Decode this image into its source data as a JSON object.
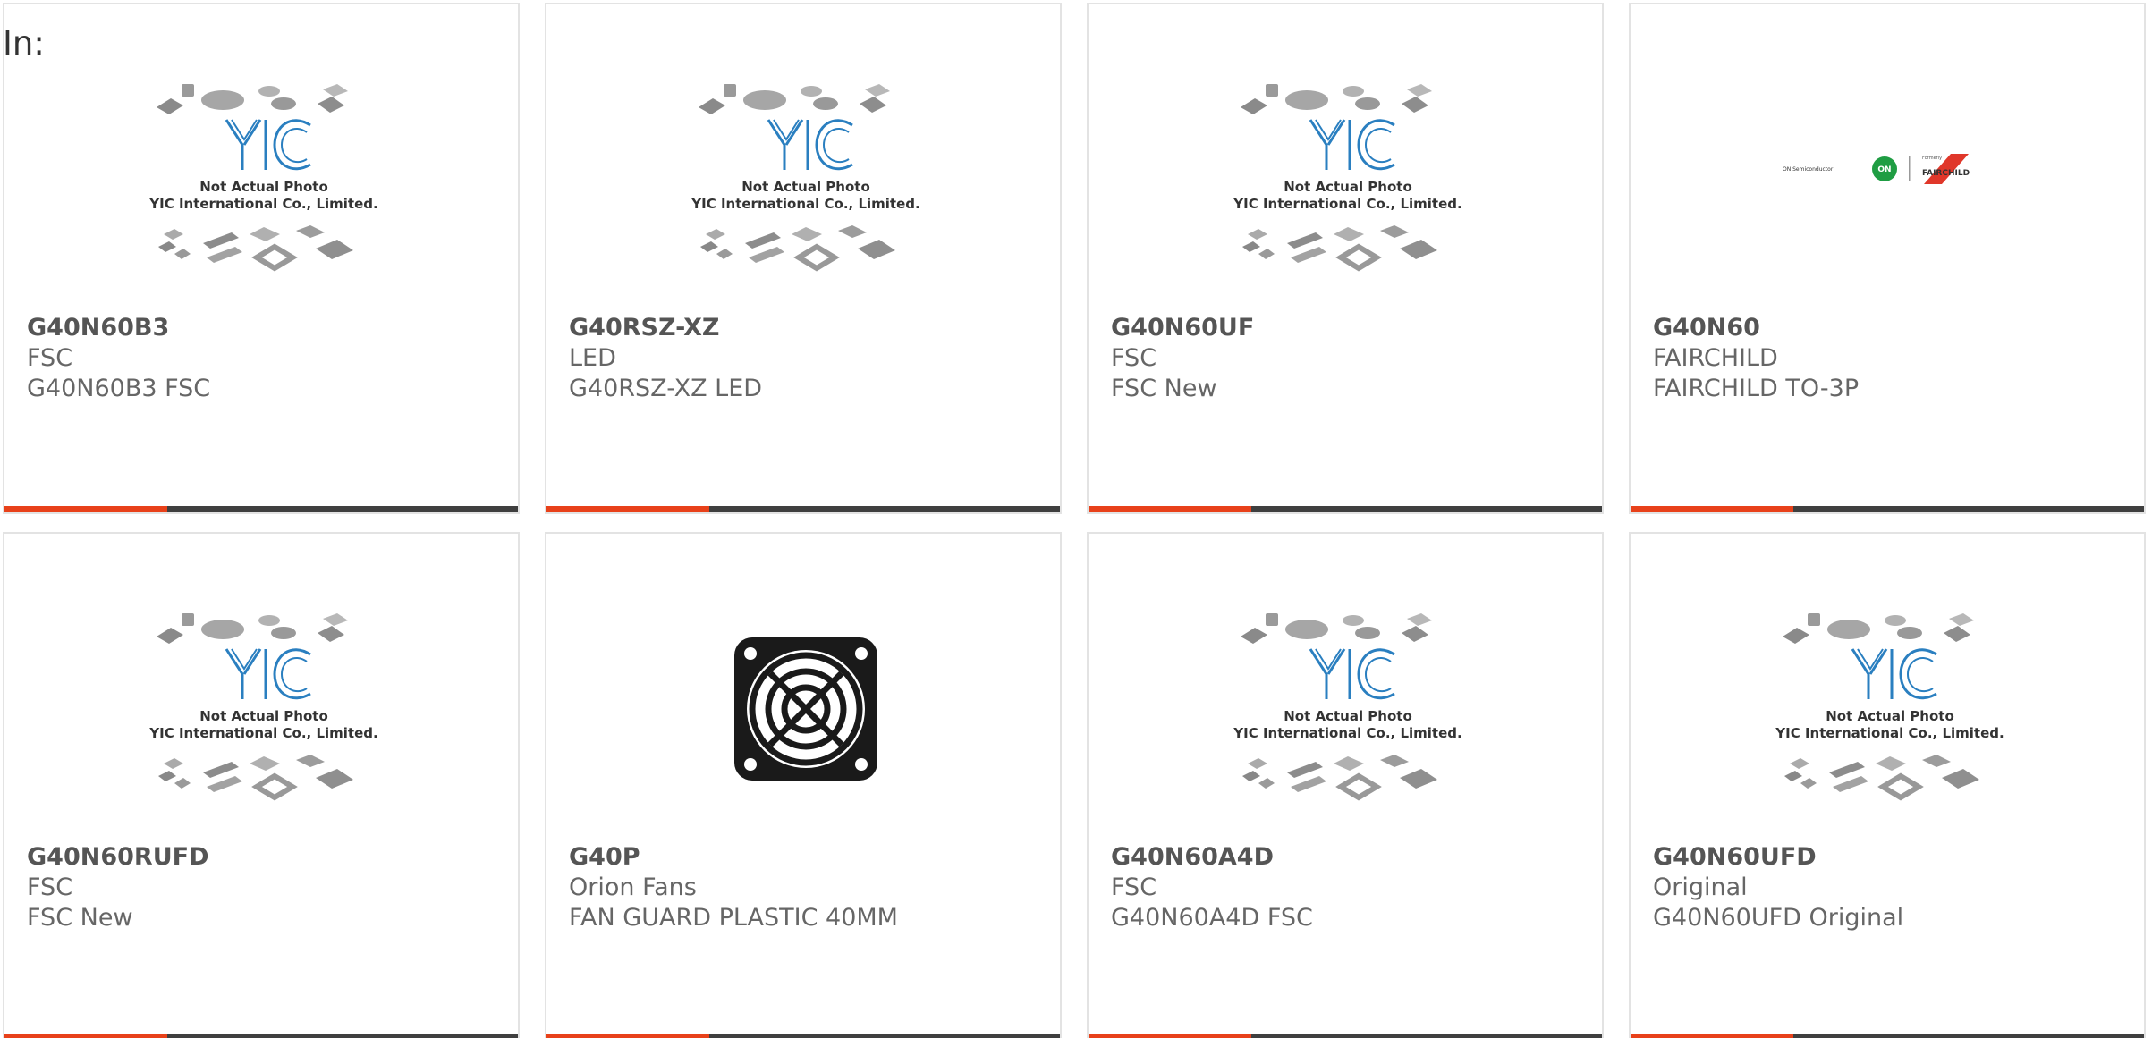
{
  "filter_label": "In:",
  "colors": {
    "accent": "#e8411a",
    "bar_dark": "#3f3f3f",
    "yic_blue": "#2a7fc0"
  },
  "placeholder_image": {
    "line1": "Not Actual Photo",
    "line2": "YIC International Co., Limited."
  },
  "fairchild_logo": {
    "brand_left": "ON Semiconductor",
    "formerly": "Formerly",
    "brand_right": "FAIRCHILD"
  },
  "products": [
    {
      "part": "G40N60B3",
      "manufacturer": "FSC",
      "description": "G40N60B3 FSC",
      "image": "yic-placeholder"
    },
    {
      "part": "G40RSZ-XZ",
      "manufacturer": "LED",
      "description": "G40RSZ-XZ LED",
      "image": "yic-placeholder"
    },
    {
      "part": "G40N60UF",
      "manufacturer": "FSC",
      "description": "FSC New",
      "image": "yic-placeholder"
    },
    {
      "part": "G40N60",
      "manufacturer": "FAIRCHILD",
      "description": "FAIRCHILD TO-3P",
      "image": "fairchild-logo"
    },
    {
      "part": "G40N60RUFD",
      "manufacturer": "FSC",
      "description": "FSC New",
      "image": "yic-placeholder"
    },
    {
      "part": "G40P",
      "manufacturer": "Orion Fans",
      "description": "FAN GUARD PLASTIC 40MM",
      "image": "fan-guard"
    },
    {
      "part": "G40N60A4D",
      "manufacturer": "FSC",
      "description": "G40N60A4D FSC",
      "image": "yic-placeholder"
    },
    {
      "part": "G40N60UFD",
      "manufacturer": "Original",
      "description": "G40N60UFD Original",
      "image": "yic-placeholder"
    }
  ]
}
